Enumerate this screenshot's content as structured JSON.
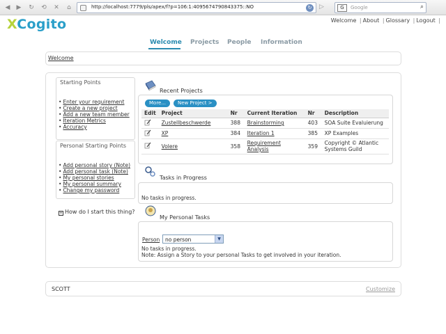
{
  "browser": {
    "url": "http://localhost:7779/pls/apex/f?p=106:1:4095674790843375::NO",
    "search_placeholder": "Google",
    "search_engine_icon": "G",
    "back_icon": "back-arrow",
    "forward_icon": "forward-arrow"
  },
  "app": {
    "logo_prefix": "X",
    "logo_rest": "Cogito",
    "top_links": [
      "Welcome",
      "About",
      "Glossary",
      "Logout"
    ],
    "tabs": [
      "Welcome",
      "Projects",
      "People",
      "Information"
    ],
    "active_tab": "Welcome",
    "accent_color": "#2a8bb0"
  },
  "breadcrumb": "Welcome",
  "sidebar": {
    "starting_points_title": "Starting Points",
    "starting_points": [
      "Enter your requirement",
      "Create a new project",
      "Add a new team member",
      "Iteration Metrics",
      "Accuracy"
    ],
    "personal_title": "Personal Starting Points",
    "personal_points": [
      "Add personal story (Note)",
      "Add personal task (Note)",
      "My personal stories",
      "My personal summary",
      "Change my password"
    ],
    "help_link": "How do I start this thing?"
  },
  "recent_projects": {
    "title": "Recent Projects",
    "more_button": "More...",
    "new_project_button": "New Project >",
    "columns": [
      "Edit",
      "Project",
      "Nr",
      "Current Iteration",
      "Nr",
      "Description"
    ],
    "rows": [
      {
        "project": "Zustellbeschwerde",
        "nr": "388",
        "iteration": "Brainstorming",
        "iter_nr": "403",
        "description": "SOA Suite Evaluierung"
      },
      {
        "project": "XP",
        "nr": "384",
        "iteration": "Iteration 1",
        "iter_nr": "385",
        "description": "XP Examples"
      },
      {
        "project": "Volere",
        "nr": "358",
        "iteration": "Requirement Analysis",
        "iter_nr": "359",
        "description": "Copyright © Atlantic Systems Guild"
      }
    ]
  },
  "tasks_in_progress": {
    "title": "Tasks in Progress",
    "empty_text": "No tasks in progress."
  },
  "personal_tasks": {
    "title": "My Personal Tasks",
    "person_label": "Person",
    "person_value": "no person",
    "empty_text": "No tasks in progress.",
    "note": "Note: Assign a Story to your personal Tasks to get involved in your iteration."
  },
  "footer": {
    "user": "SCOTT",
    "customize": "Customize"
  }
}
